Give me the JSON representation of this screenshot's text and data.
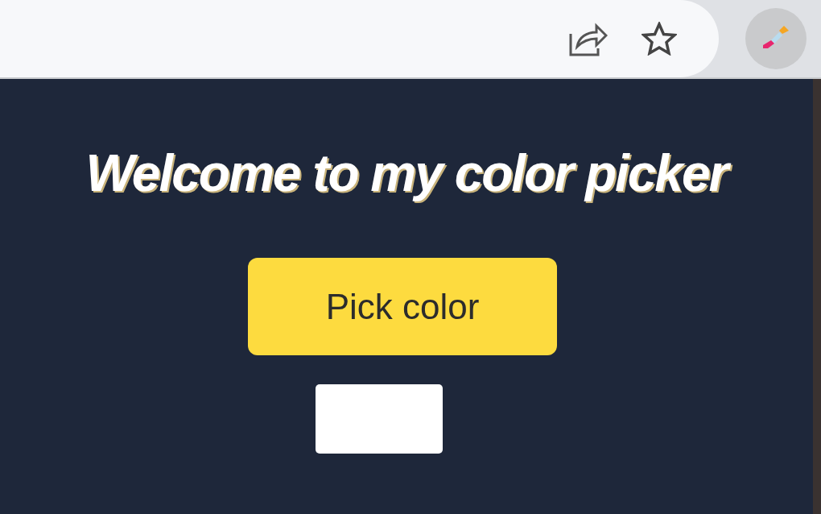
{
  "toolbar": {
    "extension_active": true
  },
  "popup": {
    "title": "Welcome to my color picker",
    "button": "Pick color",
    "swatch": {
      "color": "#ffffff"
    }
  }
}
